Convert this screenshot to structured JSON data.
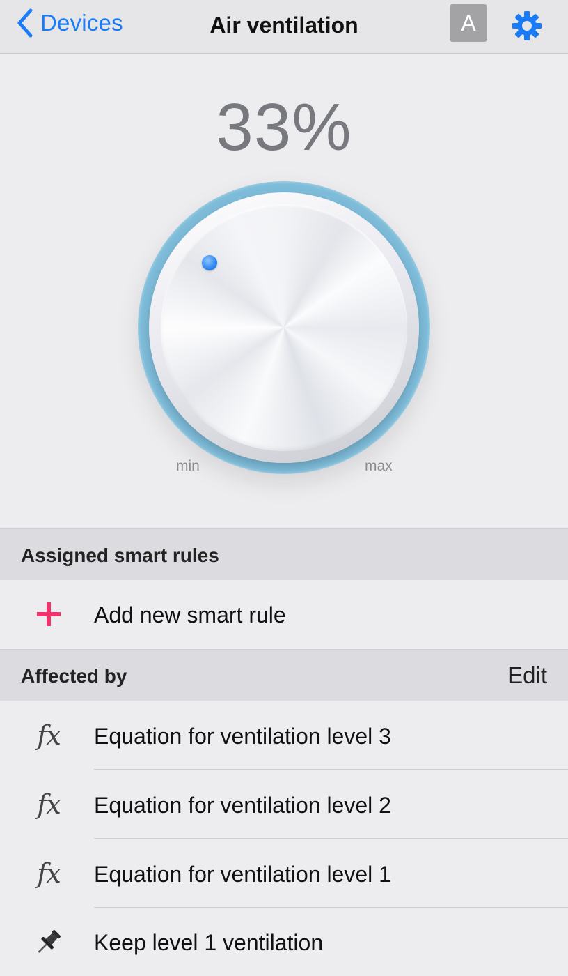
{
  "nav": {
    "back_label": "Devices",
    "title": "Air ventilation",
    "mode_badge": "A",
    "settings_icon": "gear-icon",
    "accent_color": "#1a7cf5"
  },
  "knob": {
    "level_text": "33%",
    "level_fraction": 0.33,
    "min_label": "min",
    "max_label": "max",
    "ring_color": "#7bbad8",
    "indicator_color": "#2e86f0"
  },
  "smart_rules": {
    "header": "Assigned smart rules",
    "add_label": "Add new smart rule",
    "add_icon": "plus-icon",
    "add_icon_color": "#f0336b"
  },
  "affected_by": {
    "header": "Affected by",
    "edit_label": "Edit",
    "items": [
      {
        "icon": "function-icon",
        "icon_text": "fx",
        "label": "Equation for ventilation level 3"
      },
      {
        "icon": "function-icon",
        "icon_text": "fx",
        "label": "Equation for ventilation level 2"
      },
      {
        "icon": "function-icon",
        "icon_text": "fx",
        "label": "Equation for ventilation level 1"
      },
      {
        "icon": "pin-icon",
        "label": "Keep level 1 ventilation"
      }
    ]
  }
}
